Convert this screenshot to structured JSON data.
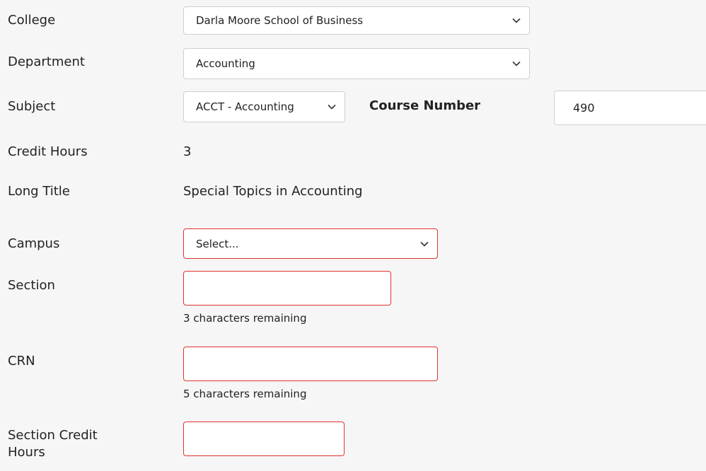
{
  "college": {
    "label": "College",
    "selected": "Darla Moore School of Business"
  },
  "department": {
    "label": "Department",
    "selected": "Accounting"
  },
  "subject": {
    "label": "Subject",
    "selected": "ACCT - Accounting"
  },
  "course_number": {
    "label": "Course Number",
    "value": "490"
  },
  "credit_hours": {
    "label": "Credit Hours",
    "value": "3"
  },
  "long_title": {
    "label": "Long Title",
    "value": "Special Topics in Accounting"
  },
  "campus": {
    "label": "Campus",
    "selected": "Select..."
  },
  "section": {
    "label": "Section",
    "value": "",
    "hint": "3 characters remaining"
  },
  "crn": {
    "label": "CRN",
    "value": "",
    "hint": "5 characters remaining"
  },
  "section_credit_hours": {
    "label_line1": "Section Credit",
    "label_line2": "Hours",
    "value": ""
  },
  "icons": {
    "dropdown": "chevron-down-icon"
  },
  "colors": {
    "invalid_border": "#e0322f",
    "background": "#f6f6f6"
  }
}
